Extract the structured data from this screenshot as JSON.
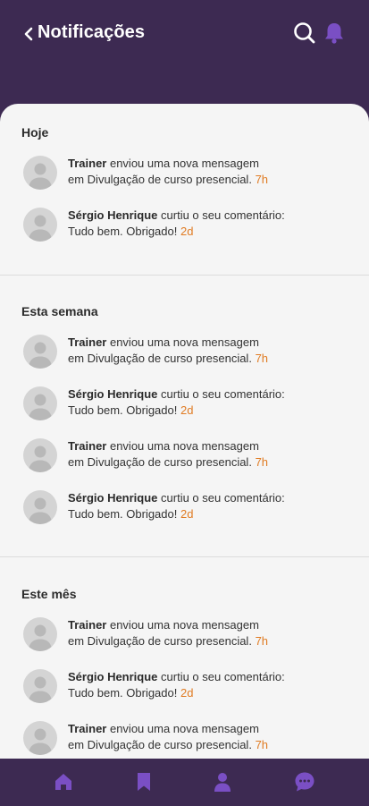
{
  "header": {
    "title": "Notificações",
    "icons": [
      "back-icon",
      "search-icon",
      "bell-icon"
    ]
  },
  "sections": [
    {
      "title": "Hoje",
      "items": [
        {
          "name": "Trainer",
          "text": " enviou uma nova mensagem",
          "line2": "em Divulgação de curso presencial.",
          "time": "7h"
        },
        {
          "name": "Sérgio Henrique",
          "text": " curtiu o seu comentário:",
          "line2": "Tudo bem. Obrigado!",
          "time": "2d"
        }
      ]
    },
    {
      "title": "Esta semana",
      "items": [
        {
          "name": "Trainer",
          "text": " enviou uma nova mensagem",
          "line2": "em Divulgação de curso presencial.",
          "time": "7h"
        },
        {
          "name": "Sérgio Henrique",
          "text": " curtiu o seu comentário:",
          "line2": "Tudo bem. Obrigado!",
          "time": "2d"
        },
        {
          "name": "Trainer",
          "text": " enviou uma nova mensagem",
          "line2": "em Divulgação de curso presencial.",
          "time": "7h"
        },
        {
          "name": "Sérgio Henrique",
          "text": " curtiu o seu comentário:",
          "line2": "Tudo bem. Obrigado!",
          "time": "2d"
        }
      ]
    },
    {
      "title": "Este mês",
      "items": [
        {
          "name": "Trainer",
          "text": " enviou uma nova mensagem",
          "line2": "em Divulgação de curso presencial.",
          "time": "7h"
        },
        {
          "name": "Sérgio Henrique",
          "text": " curtiu o seu comentário:",
          "line2": "Tudo bem. Obrigado!",
          "time": "2d"
        },
        {
          "name": "Trainer",
          "text": " enviou uma nova mensagem",
          "line2": "em Divulgação de curso presencial.",
          "time": "7h"
        }
      ]
    }
  ],
  "bottom_nav": {
    "items": [
      "home-icon",
      "bookmark-icon",
      "profile-icon",
      "chat-icon"
    ]
  },
  "colors": {
    "brand": "#3d2a52",
    "accent": "#7a4fc4",
    "time": "#e07b22",
    "background": "#f5f5f5"
  }
}
